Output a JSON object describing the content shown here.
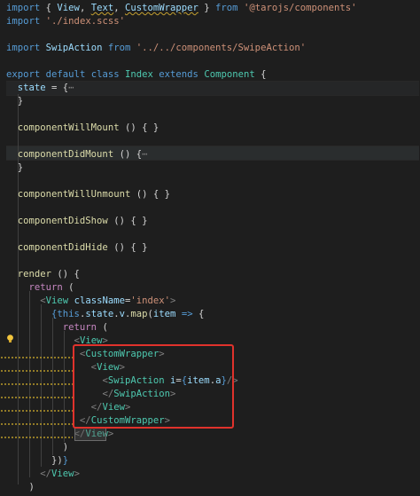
{
  "lines": [
    {
      "name": "import-components-line",
      "parts": [
        [
          "kw",
          "import"
        ],
        [
          "txt",
          " { "
        ],
        [
          "var",
          "View"
        ],
        [
          "txt",
          ", "
        ],
        [
          "var",
          "Text"
        ],
        [
          "txt",
          ", "
        ],
        [
          "var",
          "CustomWrapper"
        ],
        [
          "txt",
          " } "
        ],
        [
          "kw",
          "from"
        ],
        [
          "txt",
          " "
        ],
        [
          "str",
          "'@tarojs/components'"
        ]
      ]
    },
    {
      "name": "import-scss-line",
      "parts": [
        [
          "kw",
          "import"
        ],
        [
          "txt",
          " "
        ],
        [
          "str",
          "'./index.scss'"
        ]
      ]
    },
    {
      "name": "blank-line",
      "parts": []
    },
    {
      "name": "import-swipeaction-line",
      "parts": [
        [
          "kw",
          "import"
        ],
        [
          "txt",
          " "
        ],
        [
          "var",
          "SwipAction"
        ],
        [
          "txt",
          " "
        ],
        [
          "kw",
          "from"
        ],
        [
          "txt",
          " "
        ],
        [
          "str",
          "'../../components/SwipeAction'"
        ]
      ]
    },
    {
      "name": "blank-line",
      "parts": []
    },
    {
      "name": "class-declaration-line",
      "parts": [
        [
          "kw",
          "export"
        ],
        [
          "txt",
          " "
        ],
        [
          "kw",
          "default"
        ],
        [
          "txt",
          " "
        ],
        [
          "kw",
          "class"
        ],
        [
          "txt",
          " "
        ],
        [
          "cls",
          "Index"
        ],
        [
          "txt",
          " "
        ],
        [
          "kw",
          "extends"
        ],
        [
          "txt",
          " "
        ],
        [
          "cls",
          "Component"
        ],
        [
          "txt",
          " {"
        ]
      ]
    },
    {
      "name": "state-line",
      "parts": [
        [
          "txt",
          "  "
        ],
        [
          "var",
          "state"
        ],
        [
          "txt",
          " = {"
        ],
        [
          "br",
          "⋯"
        ]
      ]
    },
    {
      "name": "closing-brace-line",
      "parts": [
        [
          "txt",
          "  }"
        ]
      ]
    },
    {
      "name": "blank-line",
      "parts": []
    },
    {
      "name": "component-will-mount-line",
      "parts": [
        [
          "txt",
          "  "
        ],
        [
          "fn",
          "componentWillMount"
        ],
        [
          "txt",
          " () { }"
        ]
      ]
    },
    {
      "name": "blank-line",
      "parts": []
    },
    {
      "name": "component-did-mount-line",
      "parts": [
        [
          "txt",
          "  "
        ],
        [
          "fn",
          "componentDidMount"
        ],
        [
          "txt",
          " () {"
        ],
        [
          "br",
          "⋯"
        ]
      ]
    },
    {
      "name": "closing-brace-line",
      "parts": [
        [
          "txt",
          "  }"
        ]
      ]
    },
    {
      "name": "blank-line",
      "parts": []
    },
    {
      "name": "component-will-unmount-line",
      "parts": [
        [
          "txt",
          "  "
        ],
        [
          "fn",
          "componentWillUnmount"
        ],
        [
          "txt",
          " () { }"
        ]
      ]
    },
    {
      "name": "blank-line",
      "parts": []
    },
    {
      "name": "component-did-show-line",
      "parts": [
        [
          "txt",
          "  "
        ],
        [
          "fn",
          "componentDidShow"
        ],
        [
          "txt",
          " () { }"
        ]
      ]
    },
    {
      "name": "blank-line",
      "parts": []
    },
    {
      "name": "component-did-hide-line",
      "parts": [
        [
          "txt",
          "  "
        ],
        [
          "fn",
          "componentDidHide"
        ],
        [
          "txt",
          " () { }"
        ]
      ]
    },
    {
      "name": "blank-line",
      "parts": []
    },
    {
      "name": "render-line",
      "parts": [
        [
          "txt",
          "  "
        ],
        [
          "fn",
          "render"
        ],
        [
          "txt",
          " () {"
        ]
      ]
    },
    {
      "name": "return-line",
      "parts": [
        [
          "txt",
          "    "
        ],
        [
          "ctrl",
          "return"
        ],
        [
          "txt",
          " ("
        ]
      ]
    },
    {
      "name": "view-index-open-line",
      "parts": [
        [
          "txt",
          "      "
        ],
        [
          "br",
          "<"
        ],
        [
          "cls",
          "View"
        ],
        [
          "txt",
          " "
        ],
        [
          "var",
          "className"
        ],
        [
          "txt",
          "="
        ],
        [
          "str",
          "'index'"
        ],
        [
          "br",
          ">"
        ]
      ]
    },
    {
      "name": "map-line",
      "parts": [
        [
          "txt",
          "        "
        ],
        [
          "kw",
          "{"
        ],
        [
          "kw",
          "this"
        ],
        [
          "txt",
          "."
        ],
        [
          "var",
          "state"
        ],
        [
          "txt",
          "."
        ],
        [
          "var",
          "v"
        ],
        [
          "txt",
          "."
        ],
        [
          "fn",
          "map"
        ],
        [
          "txt",
          "("
        ],
        [
          "var",
          "item"
        ],
        [
          "txt",
          " "
        ],
        [
          "kw",
          "=>"
        ],
        [
          "txt",
          " {"
        ]
      ]
    },
    {
      "name": "inner-return-line",
      "parts": [
        [
          "txt",
          "          "
        ],
        [
          "ctrl",
          "return"
        ],
        [
          "txt",
          " ("
        ]
      ]
    },
    {
      "name": "view-open-line",
      "parts": [
        [
          "txt",
          "            "
        ],
        [
          "br",
          "<"
        ],
        [
          "cls",
          "View"
        ],
        [
          "br",
          ">"
        ]
      ]
    },
    {
      "name": "customwrapper-open-line",
      "parts": [
        [
          "txt",
          "             "
        ],
        [
          "br",
          "<"
        ],
        [
          "cls",
          "CustomWrapper"
        ],
        [
          "br",
          ">"
        ]
      ]
    },
    {
      "name": "inner-view-open-line",
      "parts": [
        [
          "txt",
          "               "
        ],
        [
          "br",
          "<"
        ],
        [
          "cls",
          "View"
        ],
        [
          "br",
          ">"
        ]
      ]
    },
    {
      "name": "swipaction-line",
      "parts": [
        [
          "txt",
          "                 "
        ],
        [
          "br",
          "<"
        ],
        [
          "cls",
          "SwipAction"
        ],
        [
          "txt",
          " "
        ],
        [
          "var",
          "i"
        ],
        [
          "txt",
          "="
        ],
        [
          "kw",
          "{"
        ],
        [
          "var",
          "item"
        ],
        [
          "txt",
          "."
        ],
        [
          "var",
          "a"
        ],
        [
          "kw",
          "}"
        ],
        [
          "br",
          "/>"
        ]
      ]
    },
    {
      "name": "swipaction-close-line",
      "parts": [
        [
          "txt",
          "                 "
        ],
        [
          "br",
          "</"
        ],
        [
          "cls",
          "SwipAction"
        ],
        [
          "br",
          ">"
        ]
      ]
    },
    {
      "name": "inner-view-close-line",
      "parts": [
        [
          "txt",
          "               "
        ],
        [
          "br",
          "</"
        ],
        [
          "cls",
          "View"
        ],
        [
          "br",
          ">"
        ]
      ]
    },
    {
      "name": "customwrapper-close-line",
      "parts": [
        [
          "txt",
          "             "
        ],
        [
          "br",
          "</"
        ],
        [
          "cls",
          "CustomWrapper"
        ],
        [
          "br",
          ">"
        ]
      ]
    },
    {
      "name": "view-close-line",
      "parts": [
        [
          "txt",
          "            "
        ],
        [
          "br",
          "</"
        ],
        [
          "cls",
          "View"
        ],
        [
          "br",
          ">"
        ]
      ]
    },
    {
      "name": "return-close-paren-line",
      "parts": [
        [
          "txt",
          "          )"
        ]
      ]
    },
    {
      "name": "map-close-line",
      "parts": [
        [
          "txt",
          "        "
        ],
        [
          "txt",
          "})"
        ],
        [
          "kw",
          "}"
        ]
      ]
    },
    {
      "name": "view-index-close-line",
      "parts": [
        [
          "txt",
          "      "
        ],
        [
          "br",
          "</"
        ],
        [
          "cls",
          "View"
        ],
        [
          "br",
          ">"
        ]
      ]
    },
    {
      "name": "render-return-close-line",
      "parts": [
        [
          "txt",
          "    )"
        ]
      ]
    }
  ],
  "colors": {
    "background": "#1e1e1e",
    "keyword": "#569cd6",
    "control": "#c586c0",
    "string": "#ce9178",
    "class": "#4ec9b0",
    "variable": "#9cdcfe",
    "function": "#dcdcaa",
    "highlight-box": "#e0322c"
  },
  "icons": {
    "lightbulb": "lightbulb-icon"
  }
}
